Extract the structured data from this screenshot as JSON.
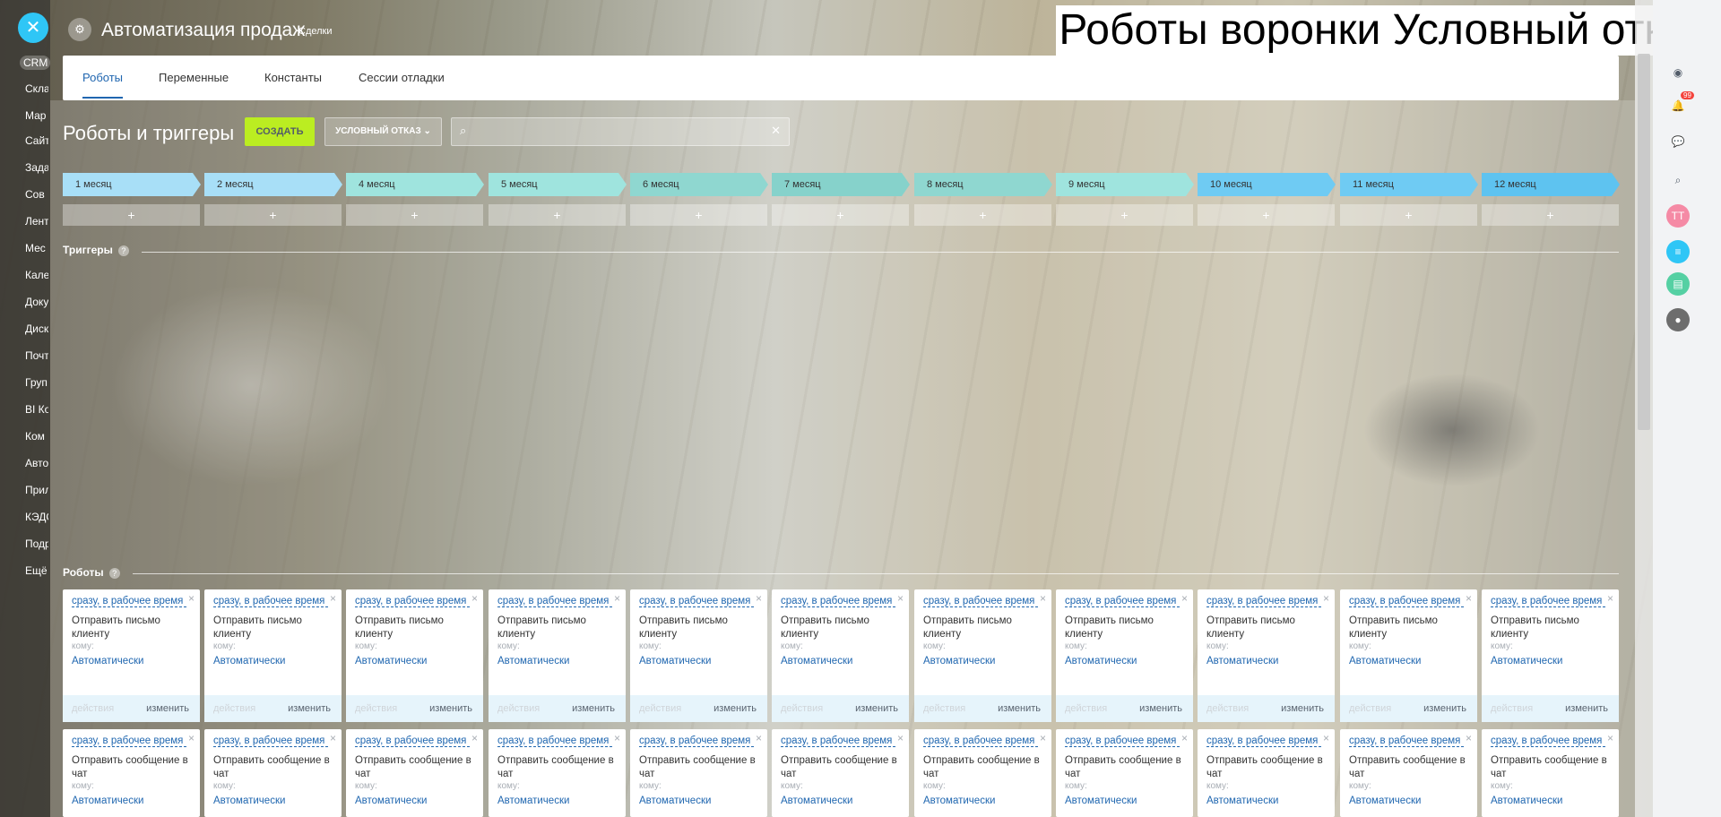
{
  "app": {
    "title": "Автоматизация продаж",
    "subtitle": "Сделки"
  },
  "overlay_title": "Роботы воронки Условный отказ",
  "left_sidebar": {
    "items": [
      "CRM",
      "Скла",
      "Мар",
      "Сайт",
      "Зада",
      "Сов",
      "Лент",
      "Мес",
      "Кале",
      "Доку",
      "Диск",
      "Почт",
      "Груп",
      "BI Ко",
      "Ком",
      "Авто",
      "Прил",
      "КЭДО",
      "Подр",
      "Ещё"
    ]
  },
  "tabs": [
    "Роботы",
    "Переменные",
    "Константы",
    "Сессии отладки"
  ],
  "page": {
    "title": "Роботы и триггеры",
    "create_label": "СОЗДАТЬ",
    "funnel_label": "УСЛОВНЫЙ ОТКАЗ",
    "search_placeholder": ""
  },
  "stages": [
    {
      "name": "1 месяц",
      "color": "#a8dff7"
    },
    {
      "name": "2 месяц",
      "color": "#a8dff7"
    },
    {
      "name": "4 месяц",
      "color": "#9fe4de"
    },
    {
      "name": "5 месяц",
      "color": "#9fe4de"
    },
    {
      "name": "6 месяц",
      "color": "#8fd7d0"
    },
    {
      "name": "7 месяц",
      "color": "#86d2cb"
    },
    {
      "name": "8 месяц",
      "color": "#8fd7d0"
    },
    {
      "name": "9 месяц",
      "color": "#9fe4de"
    },
    {
      "name": "10 месяц",
      "color": "#6fcbf3"
    },
    {
      "name": "11 месяц",
      "color": "#6fcbf3"
    },
    {
      "name": "12 месяц",
      "color": "#5ec3f0"
    }
  ],
  "plus": "+",
  "sections": {
    "triggers": "Триггеры",
    "robots": "Роботы"
  },
  "robots_row1": {
    "when": "сразу, в рабочее время",
    "title": "Отправить письмо клиенту",
    "to": "кому:",
    "auto": "Автоматически",
    "actions": "действия",
    "change": "изменить"
  },
  "robots_row2": {
    "when": "сразу, в рабочее время",
    "title": "Отправить сообщение в чат",
    "to": "кому:",
    "auto": "Автоматически"
  },
  "right_sidebar": {
    "avatar_initials": "TT",
    "notif_count": "99"
  },
  "colors": {
    "accent": "#2066b0",
    "create": "#bbed21",
    "link": "#2067b0"
  }
}
